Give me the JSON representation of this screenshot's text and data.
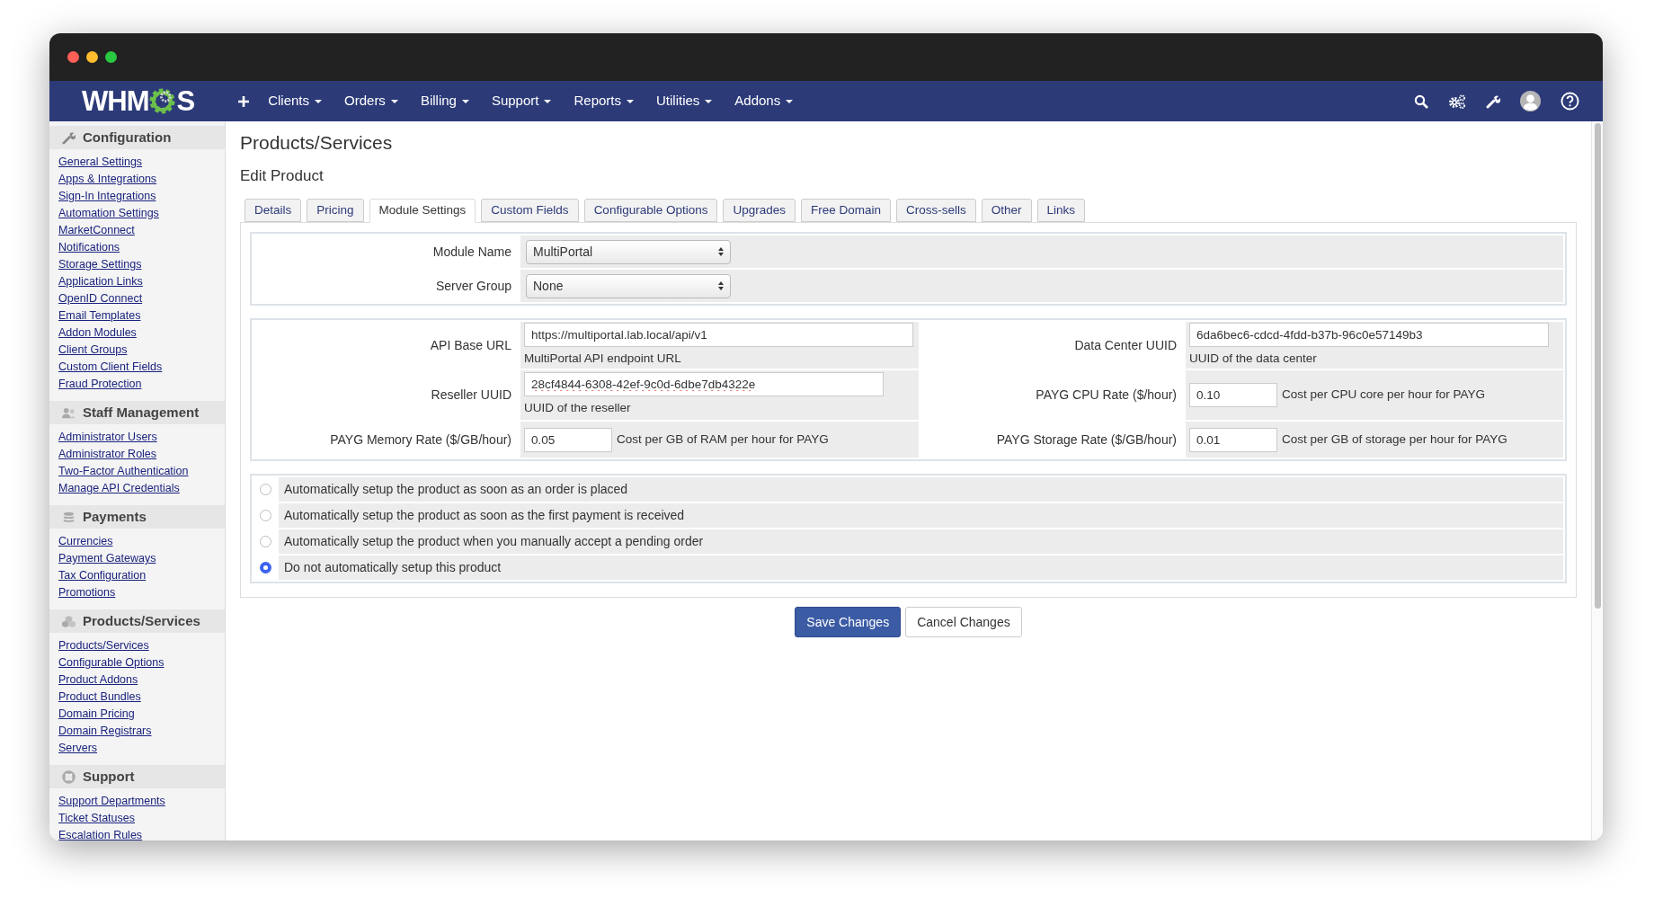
{
  "logo": {
    "before": "WHM",
    "after": "S"
  },
  "nav": [
    "Clients",
    "Orders",
    "Billing",
    "Support",
    "Reports",
    "Utilities",
    "Addons"
  ],
  "sidebar": [
    {
      "title": "Configuration",
      "links": [
        "General Settings",
        "Apps & Integrations",
        "Sign-In Integrations",
        "Automation Settings",
        "MarketConnect",
        "Notifications",
        "Storage Settings",
        "Application Links",
        "OpenID Connect",
        "Email Templates",
        "Addon Modules",
        "Client Groups",
        "Custom Client Fields",
        "Fraud Protection"
      ]
    },
    {
      "title": "Staff Management",
      "links": [
        "Administrator Users",
        "Administrator Roles",
        "Two-Factor Authentication",
        "Manage API Credentials"
      ]
    },
    {
      "title": "Payments",
      "links": [
        "Currencies",
        "Payment Gateways",
        "Tax Configuration",
        "Promotions"
      ]
    },
    {
      "title": "Products/Services",
      "links": [
        "Products/Services",
        "Configurable Options",
        "Product Addons",
        "Product Bundles",
        "Domain Pricing",
        "Domain Registrars",
        "Servers"
      ]
    },
    {
      "title": "Support",
      "links": [
        "Support Departments",
        "Ticket Statuses",
        "Escalation Rules"
      ]
    }
  ],
  "page_title": "Products/Services",
  "subtitle": "Edit Product",
  "tabs": [
    {
      "label": "Details",
      "selected": false
    },
    {
      "label": "Pricing",
      "selected": false
    },
    {
      "label": "Module Settings",
      "selected": true
    },
    {
      "label": "Custom Fields",
      "selected": false
    },
    {
      "label": "Configurable Options",
      "selected": false
    },
    {
      "label": "Upgrades",
      "selected": false
    },
    {
      "label": "Free Domain",
      "selected": false
    },
    {
      "label": "Cross-sells",
      "selected": false
    },
    {
      "label": "Other",
      "selected": false
    },
    {
      "label": "Links",
      "selected": false
    }
  ],
  "module_settings": [
    {
      "label": "Module Name",
      "value": "MultiPortal"
    },
    {
      "label": "Server Group",
      "value": "None"
    }
  ],
  "config_rows": [
    [
      {
        "kind": "wide",
        "label": "API Base URL",
        "value": "https://multiportal.lab.local/api/v1",
        "help": "MultiPortal API endpoint URL"
      },
      {
        "kind": "wide",
        "label": "Data Center UUID",
        "value": "6da6bec6-cdcd-4fdd-b37b-96c0e57149b3",
        "help": "UUID of the data center"
      }
    ],
    [
      {
        "kind": "medium",
        "label": "Reseller UUID",
        "value": "28cf4844-6308-42ef-9c0d-6dbe7db4322e",
        "help": "UUID of the reseller"
      },
      {
        "kind": "rate",
        "label": "PAYG CPU Rate ($/hour)",
        "value": "0.10",
        "help": "Cost per CPU core per hour for PAYG"
      }
    ],
    [
      {
        "kind": "rate",
        "label": "PAYG Memory Rate ($/GB/hour)",
        "value": "0.05",
        "help": "Cost per GB of RAM per hour for PAYG"
      },
      {
        "kind": "rate",
        "label": "PAYG Storage Rate ($/GB/hour)",
        "value": "0.01",
        "help": "Cost per GB of storage per hour for PAYG"
      }
    ]
  ],
  "setup_options": [
    {
      "label": "Automatically setup the product as soon as an order is placed",
      "selected": false
    },
    {
      "label": "Automatically setup the product as soon as the first payment is received",
      "selected": false
    },
    {
      "label": "Automatically setup the product when you manually accept a pending order",
      "selected": false
    },
    {
      "label": "Do not automatically setup this product",
      "selected": true
    }
  ],
  "buttons": [
    {
      "kind": "primary",
      "label": "Save Changes"
    },
    {
      "kind": "secondary",
      "label": "Cancel Changes"
    }
  ]
}
